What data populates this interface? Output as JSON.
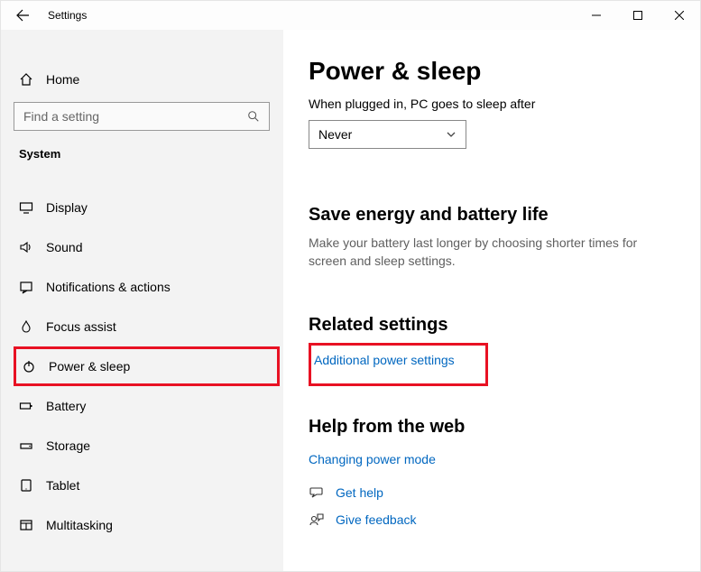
{
  "window": {
    "title": "Settings"
  },
  "sidebar": {
    "home": "Home",
    "search_placeholder": "Find a setting",
    "category": "System",
    "items": [
      {
        "label": "Display"
      },
      {
        "label": "Sound"
      },
      {
        "label": "Notifications & actions"
      },
      {
        "label": "Focus assist"
      },
      {
        "label": "Power & sleep"
      },
      {
        "label": "Battery"
      },
      {
        "label": "Storage"
      },
      {
        "label": "Tablet"
      },
      {
        "label": "Multitasking"
      }
    ]
  },
  "main": {
    "title": "Power & sleep",
    "plugged_label": "When plugged in, PC goes to sleep after",
    "plugged_value": "Never",
    "energy_heading": "Save energy and battery life",
    "energy_text": "Make your battery last longer by choosing shorter times for screen and sleep settings.",
    "related_heading": "Related settings",
    "related_link": "Additional power settings",
    "help_heading": "Help from the web",
    "help_link": "Changing power mode",
    "get_help": "Get help",
    "give_feedback": "Give feedback"
  }
}
